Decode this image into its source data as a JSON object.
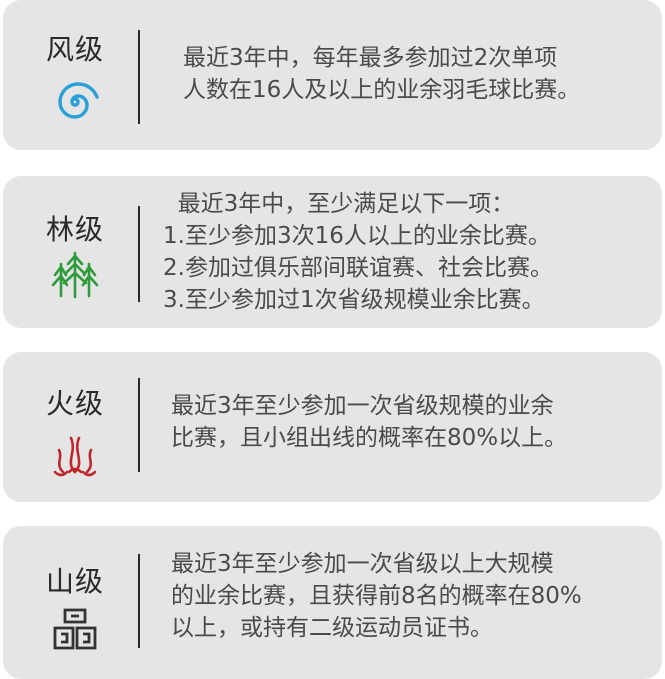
{
  "levels": [
    {
      "name": "风级",
      "icon": "wind-swirl-icon",
      "color": "#2a9fd8",
      "lines": [
        "最近3年中，每年最多参加过2次单项",
        "人数在16人及以上的业余羽毛球比赛。"
      ]
    },
    {
      "name": "林级",
      "icon": "forest-trees-icon",
      "color": "#2e9a3a",
      "lines": [
        "  最近3年中，至少满足以下一项：",
        "1.至少参加3次16人以上的业余比赛。",
        "2.参加过俱乐部间联谊赛、社会比赛。",
        "3.至少参加过1次省级规模业余比赛。"
      ]
    },
    {
      "name": "火级",
      "icon": "fire-flame-icon",
      "color": "#c0272d",
      "lines": [
        "最近3年至少参加一次省级规模的业余",
        "比赛，且小组出线的概率在80%以上。"
      ]
    },
    {
      "name": "山级",
      "icon": "mountain-glyph-icon",
      "color": "#333333",
      "lines": [
        "最近3年至少参加一次省级以上大规模",
        "的业余比赛，且获得前8名的概率在80%",
        "以上，或持有二级运动员证书。"
      ]
    }
  ]
}
